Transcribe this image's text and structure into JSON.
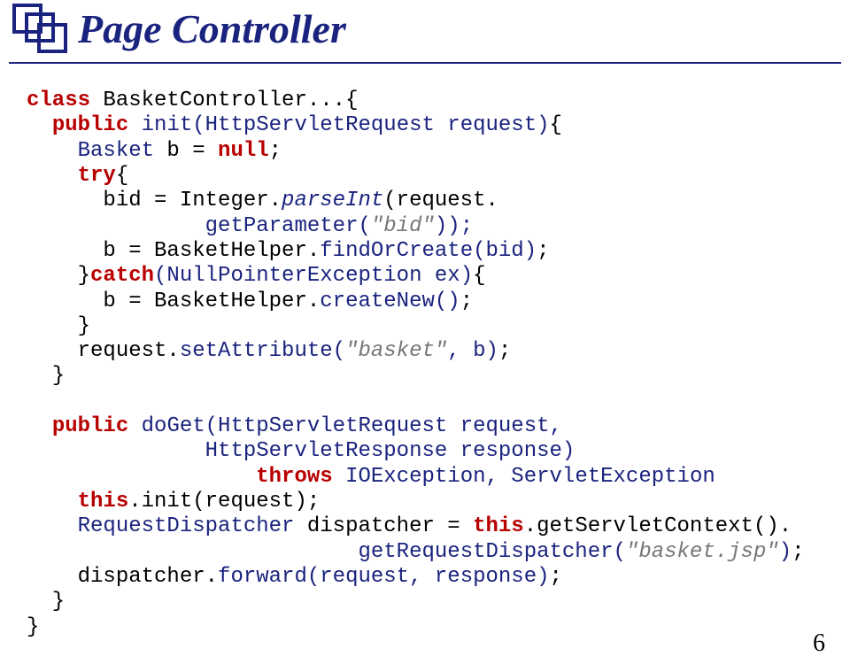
{
  "title": "Page Controller",
  "page_number": "6",
  "code": {
    "l01_class": "class",
    "l01_rest": " BasketController...{",
    "l02_lead": "  ",
    "l02_public": "public",
    "l02_sp": " ",
    "l02_init": "init(HttpServletRequest request)",
    "l02_brace": "{",
    "l03_lead": "    ",
    "l03_basket": "Basket",
    "l03_mid": " b = ",
    "l03_null": "null",
    "l03_semi": ";",
    "l04_lead": "    ",
    "l04_try": "try",
    "l04_brace": "{",
    "l05_lead": "      bid = Integer.",
    "l05_parseInt": "parseInt",
    "l05_open": "(request.",
    "l06_lead": "              ",
    "l06_getParam": "getParameter(",
    "l06_str": "\"bid\"",
    "l06_close": "));",
    "l07_lead": "      b = BasketHelper.",
    "l07_find": "findOrCreate(bid)",
    "l07_semi": ";",
    "l08_lead": "    }",
    "l08_catch": "catch",
    "l08_args": "(NullPointerException ex)",
    "l08_brace": "{",
    "l09_lead": "      b = BasketHelper.",
    "l09_create": "createNew()",
    "l09_semi": ";",
    "l10": "    }",
    "l11_lead": "    request.",
    "l11_setAttr_a": "setAttribute(",
    "l11_str": "\"basket\"",
    "l11_setAttr_b": ", b)",
    "l11_semi": ";",
    "l12": "  }",
    "blank": "",
    "l14_lead": "  ",
    "l14_public": "public",
    "l14_sp": " ",
    "l14_doGet": "doGet(HttpServletRequest request,",
    "l15_lead": "              ",
    "l15_rest": "HttpServletResponse response)",
    "l16_lead": "                  ",
    "l16_throws": "throws",
    "l16_sp": " ",
    "l16_ex": "IOException, ServletException",
    "l17_lead": "    ",
    "l17_this": "this",
    "l17_init": ".init(request);",
    "l18_lead": "    ",
    "l18_type": "RequestDispatcher",
    "l18_mid": " dispatcher = ",
    "l18_this": "this",
    "l18_call": ".getServletContext().",
    "l19_lead": "                          ",
    "l19_call_a": "getRequestDispatcher(",
    "l19_str": "\"basket.jsp\"",
    "l19_call_b": ")",
    "l19_semi": ";",
    "l20_lead": "    dispatcher.",
    "l20_fwd": "forward(request, response)",
    "l20_semi": ";",
    "l21": "  }",
    "l22": "}"
  }
}
